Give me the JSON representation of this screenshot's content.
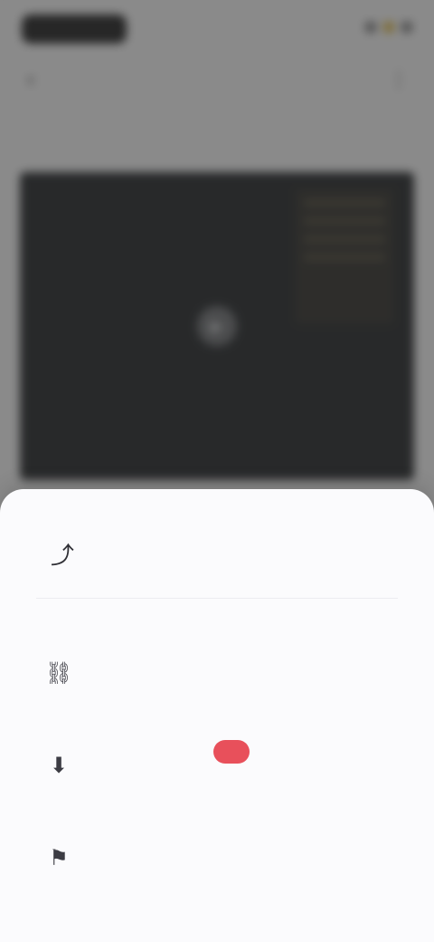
{
  "status_bar": {
    "icon_names": [
      "signal-icon",
      "wifi-icon",
      "battery-icon"
    ],
    "accent_color": "#d9b33b"
  },
  "background_app": {
    "back_icon": "back-arrow-icon",
    "title": "",
    "menu_icon": "menu-icon",
    "tabs": [
      "",
      "",
      "",
      "",
      ""
    ],
    "video": {
      "play_icon": "play-icon"
    }
  },
  "sheet": {
    "header_icon": "share-icon",
    "title": "",
    "close_label": "",
    "options": [
      {
        "icon": "link-icon",
        "title": "",
        "description": ""
      },
      {
        "icon": "download-icon",
        "title": "",
        "description": "",
        "badge": ""
      },
      {
        "icon": "report-icon",
        "title": "",
        "description": ""
      }
    ]
  },
  "colors": {
    "badge": "#e8505b",
    "sheet_bg": "#fbfbfd",
    "video_bg": "#1e2123"
  }
}
